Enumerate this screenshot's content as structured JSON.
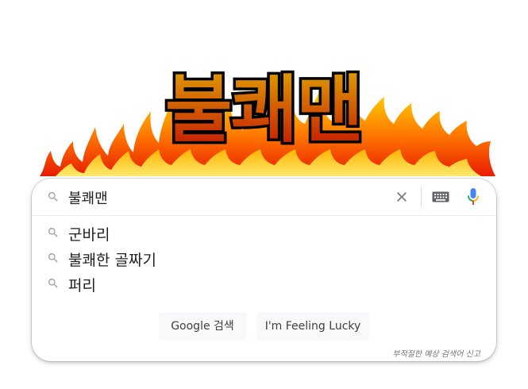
{
  "logo": {
    "text": "불쾌맨",
    "icon": "flame-logo",
    "colors": {
      "top": "#e0a000",
      "bottom": "#c41200",
      "outline": "#000000"
    }
  },
  "search": {
    "query": "불쾌맨",
    "icons": {
      "search": "search-icon",
      "clear": "close-icon",
      "keyboard": "keyboard-icon",
      "voice": "microphone-icon"
    }
  },
  "suggestions": [
    {
      "label": "군바리"
    },
    {
      "label": "불쾌한 골짜기"
    },
    {
      "label": "퍼리"
    }
  ],
  "buttons": {
    "search_label": "Google 검색",
    "lucky_label": "I'm Feeling Lucky"
  },
  "report_label": "부적절한 예상 검색어 신고"
}
